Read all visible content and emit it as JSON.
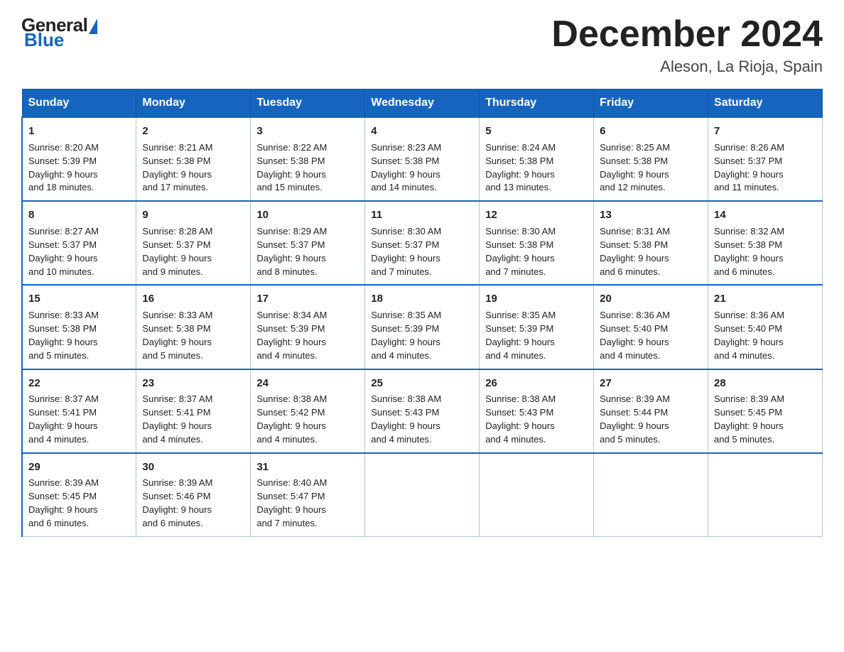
{
  "logo": {
    "general": "General",
    "blue": "Blue"
  },
  "title": "December 2024",
  "location": "Aleson, La Rioja, Spain",
  "days_of_week": [
    "Sunday",
    "Monday",
    "Tuesday",
    "Wednesday",
    "Thursday",
    "Friday",
    "Saturday"
  ],
  "weeks": [
    [
      {
        "day": "1",
        "sunrise": "Sunrise: 8:20 AM",
        "sunset": "Sunset: 5:39 PM",
        "daylight": "Daylight: 9 hours",
        "daylight2": "and 18 minutes."
      },
      {
        "day": "2",
        "sunrise": "Sunrise: 8:21 AM",
        "sunset": "Sunset: 5:38 PM",
        "daylight": "Daylight: 9 hours",
        "daylight2": "and 17 minutes."
      },
      {
        "day": "3",
        "sunrise": "Sunrise: 8:22 AM",
        "sunset": "Sunset: 5:38 PM",
        "daylight": "Daylight: 9 hours",
        "daylight2": "and 15 minutes."
      },
      {
        "day": "4",
        "sunrise": "Sunrise: 8:23 AM",
        "sunset": "Sunset: 5:38 PM",
        "daylight": "Daylight: 9 hours",
        "daylight2": "and 14 minutes."
      },
      {
        "day": "5",
        "sunrise": "Sunrise: 8:24 AM",
        "sunset": "Sunset: 5:38 PM",
        "daylight": "Daylight: 9 hours",
        "daylight2": "and 13 minutes."
      },
      {
        "day": "6",
        "sunrise": "Sunrise: 8:25 AM",
        "sunset": "Sunset: 5:38 PM",
        "daylight": "Daylight: 9 hours",
        "daylight2": "and 12 minutes."
      },
      {
        "day": "7",
        "sunrise": "Sunrise: 8:26 AM",
        "sunset": "Sunset: 5:37 PM",
        "daylight": "Daylight: 9 hours",
        "daylight2": "and 11 minutes."
      }
    ],
    [
      {
        "day": "8",
        "sunrise": "Sunrise: 8:27 AM",
        "sunset": "Sunset: 5:37 PM",
        "daylight": "Daylight: 9 hours",
        "daylight2": "and 10 minutes."
      },
      {
        "day": "9",
        "sunrise": "Sunrise: 8:28 AM",
        "sunset": "Sunset: 5:37 PM",
        "daylight": "Daylight: 9 hours",
        "daylight2": "and 9 minutes."
      },
      {
        "day": "10",
        "sunrise": "Sunrise: 8:29 AM",
        "sunset": "Sunset: 5:37 PM",
        "daylight": "Daylight: 9 hours",
        "daylight2": "and 8 minutes."
      },
      {
        "day": "11",
        "sunrise": "Sunrise: 8:30 AM",
        "sunset": "Sunset: 5:37 PM",
        "daylight": "Daylight: 9 hours",
        "daylight2": "and 7 minutes."
      },
      {
        "day": "12",
        "sunrise": "Sunrise: 8:30 AM",
        "sunset": "Sunset: 5:38 PM",
        "daylight": "Daylight: 9 hours",
        "daylight2": "and 7 minutes."
      },
      {
        "day": "13",
        "sunrise": "Sunrise: 8:31 AM",
        "sunset": "Sunset: 5:38 PM",
        "daylight": "Daylight: 9 hours",
        "daylight2": "and 6 minutes."
      },
      {
        "day": "14",
        "sunrise": "Sunrise: 8:32 AM",
        "sunset": "Sunset: 5:38 PM",
        "daylight": "Daylight: 9 hours",
        "daylight2": "and 6 minutes."
      }
    ],
    [
      {
        "day": "15",
        "sunrise": "Sunrise: 8:33 AM",
        "sunset": "Sunset: 5:38 PM",
        "daylight": "Daylight: 9 hours",
        "daylight2": "and 5 minutes."
      },
      {
        "day": "16",
        "sunrise": "Sunrise: 8:33 AM",
        "sunset": "Sunset: 5:38 PM",
        "daylight": "Daylight: 9 hours",
        "daylight2": "and 5 minutes."
      },
      {
        "day": "17",
        "sunrise": "Sunrise: 8:34 AM",
        "sunset": "Sunset: 5:39 PM",
        "daylight": "Daylight: 9 hours",
        "daylight2": "and 4 minutes."
      },
      {
        "day": "18",
        "sunrise": "Sunrise: 8:35 AM",
        "sunset": "Sunset: 5:39 PM",
        "daylight": "Daylight: 9 hours",
        "daylight2": "and 4 minutes."
      },
      {
        "day": "19",
        "sunrise": "Sunrise: 8:35 AM",
        "sunset": "Sunset: 5:39 PM",
        "daylight": "Daylight: 9 hours",
        "daylight2": "and 4 minutes."
      },
      {
        "day": "20",
        "sunrise": "Sunrise: 8:36 AM",
        "sunset": "Sunset: 5:40 PM",
        "daylight": "Daylight: 9 hours",
        "daylight2": "and 4 minutes."
      },
      {
        "day": "21",
        "sunrise": "Sunrise: 8:36 AM",
        "sunset": "Sunset: 5:40 PM",
        "daylight": "Daylight: 9 hours",
        "daylight2": "and 4 minutes."
      }
    ],
    [
      {
        "day": "22",
        "sunrise": "Sunrise: 8:37 AM",
        "sunset": "Sunset: 5:41 PM",
        "daylight": "Daylight: 9 hours",
        "daylight2": "and 4 minutes."
      },
      {
        "day": "23",
        "sunrise": "Sunrise: 8:37 AM",
        "sunset": "Sunset: 5:41 PM",
        "daylight": "Daylight: 9 hours",
        "daylight2": "and 4 minutes."
      },
      {
        "day": "24",
        "sunrise": "Sunrise: 8:38 AM",
        "sunset": "Sunset: 5:42 PM",
        "daylight": "Daylight: 9 hours",
        "daylight2": "and 4 minutes."
      },
      {
        "day": "25",
        "sunrise": "Sunrise: 8:38 AM",
        "sunset": "Sunset: 5:43 PM",
        "daylight": "Daylight: 9 hours",
        "daylight2": "and 4 minutes."
      },
      {
        "day": "26",
        "sunrise": "Sunrise: 8:38 AM",
        "sunset": "Sunset: 5:43 PM",
        "daylight": "Daylight: 9 hours",
        "daylight2": "and 4 minutes."
      },
      {
        "day": "27",
        "sunrise": "Sunrise: 8:39 AM",
        "sunset": "Sunset: 5:44 PM",
        "daylight": "Daylight: 9 hours",
        "daylight2": "and 5 minutes."
      },
      {
        "day": "28",
        "sunrise": "Sunrise: 8:39 AM",
        "sunset": "Sunset: 5:45 PM",
        "daylight": "Daylight: 9 hours",
        "daylight2": "and 5 minutes."
      }
    ],
    [
      {
        "day": "29",
        "sunrise": "Sunrise: 8:39 AM",
        "sunset": "Sunset: 5:45 PM",
        "daylight": "Daylight: 9 hours",
        "daylight2": "and 6 minutes."
      },
      {
        "day": "30",
        "sunrise": "Sunrise: 8:39 AM",
        "sunset": "Sunset: 5:46 PM",
        "daylight": "Daylight: 9 hours",
        "daylight2": "and 6 minutes."
      },
      {
        "day": "31",
        "sunrise": "Sunrise: 8:40 AM",
        "sunset": "Sunset: 5:47 PM",
        "daylight": "Daylight: 9 hours",
        "daylight2": "and 7 minutes."
      },
      {
        "day": "",
        "sunrise": "",
        "sunset": "",
        "daylight": "",
        "daylight2": ""
      },
      {
        "day": "",
        "sunrise": "",
        "sunset": "",
        "daylight": "",
        "daylight2": ""
      },
      {
        "day": "",
        "sunrise": "",
        "sunset": "",
        "daylight": "",
        "daylight2": ""
      },
      {
        "day": "",
        "sunrise": "",
        "sunset": "",
        "daylight": "",
        "daylight2": ""
      }
    ]
  ]
}
